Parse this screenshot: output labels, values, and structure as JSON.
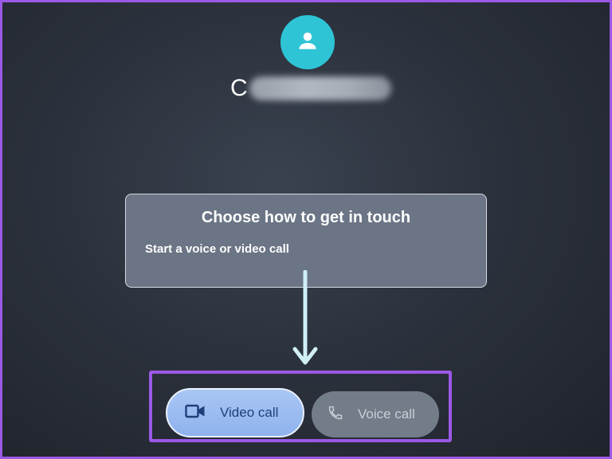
{
  "contact": {
    "initial": "C"
  },
  "prompt": {
    "title": "Choose how to get in touch",
    "subtitle": "Start a voice or video call"
  },
  "actions": {
    "video_call_label": "Video call",
    "voice_call_label": "Voice call",
    "video_icon": "videocam-icon",
    "voice_icon": "phone-icon"
  },
  "colors": {
    "avatar": "#2ec4d6",
    "highlight": "#9b59e6",
    "video_button": "#9dbcf1",
    "voice_button": "#737c89"
  }
}
